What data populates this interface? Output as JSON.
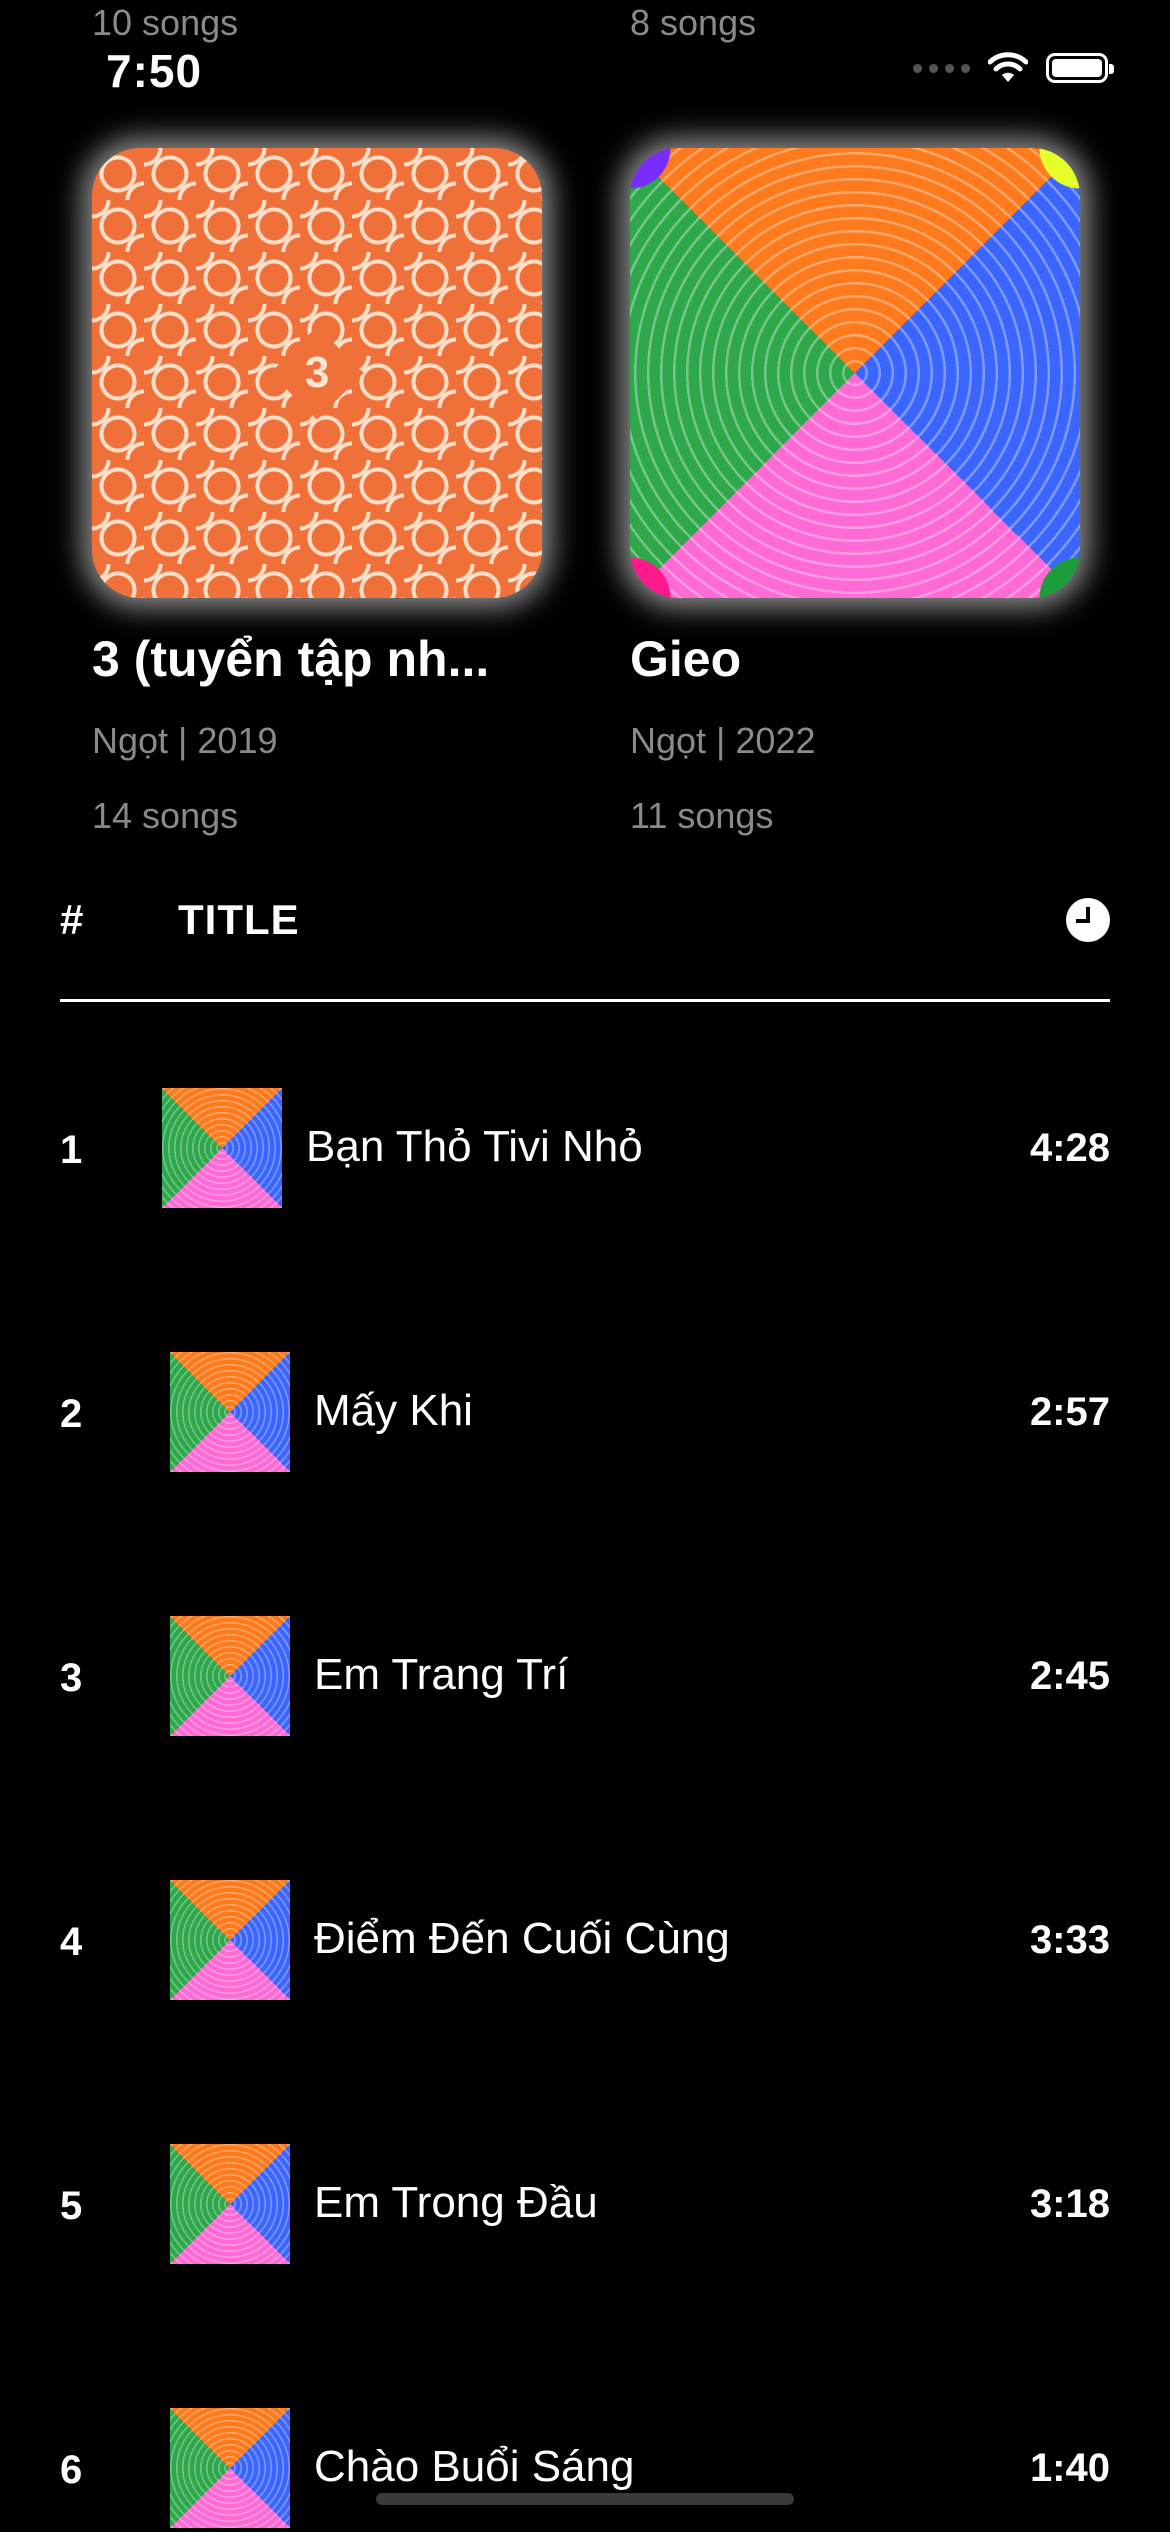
{
  "status_bar": {
    "time": "7:50"
  },
  "top_partial": {
    "left_count": "10 songs",
    "right_count": "8 songs"
  },
  "albums": [
    {
      "title": "3 (tuyển tập nh...",
      "meta": "Ngọt | 2019",
      "count": "14 songs",
      "cover_mark": "3"
    },
    {
      "title": "Gieo",
      "meta": "Ngọt | 2022",
      "count": "11 songs"
    }
  ],
  "table_header": {
    "number": "#",
    "title": "TITLE"
  },
  "tracks": [
    {
      "num": "1",
      "title": "Bạn Thỏ Tivi Nhỏ",
      "duration": "4:28"
    },
    {
      "num": "2",
      "title": "Mấy Khi",
      "duration": "2:57"
    },
    {
      "num": "3",
      "title": "Em Trang Trí",
      "duration": "2:45"
    },
    {
      "num": "4",
      "title": "Điểm Đến Cuối Cùng",
      "duration": "3:33"
    },
    {
      "num": "5",
      "title": "Em Trong Đầu",
      "duration": "3:18"
    },
    {
      "num": "6",
      "title": "Chào Buổi Sáng",
      "duration": "1:40"
    }
  ],
  "icons": {
    "clock": "clock-icon",
    "wifi": "wifi-icon",
    "battery": "battery-icon",
    "signal": "signal-icon"
  }
}
